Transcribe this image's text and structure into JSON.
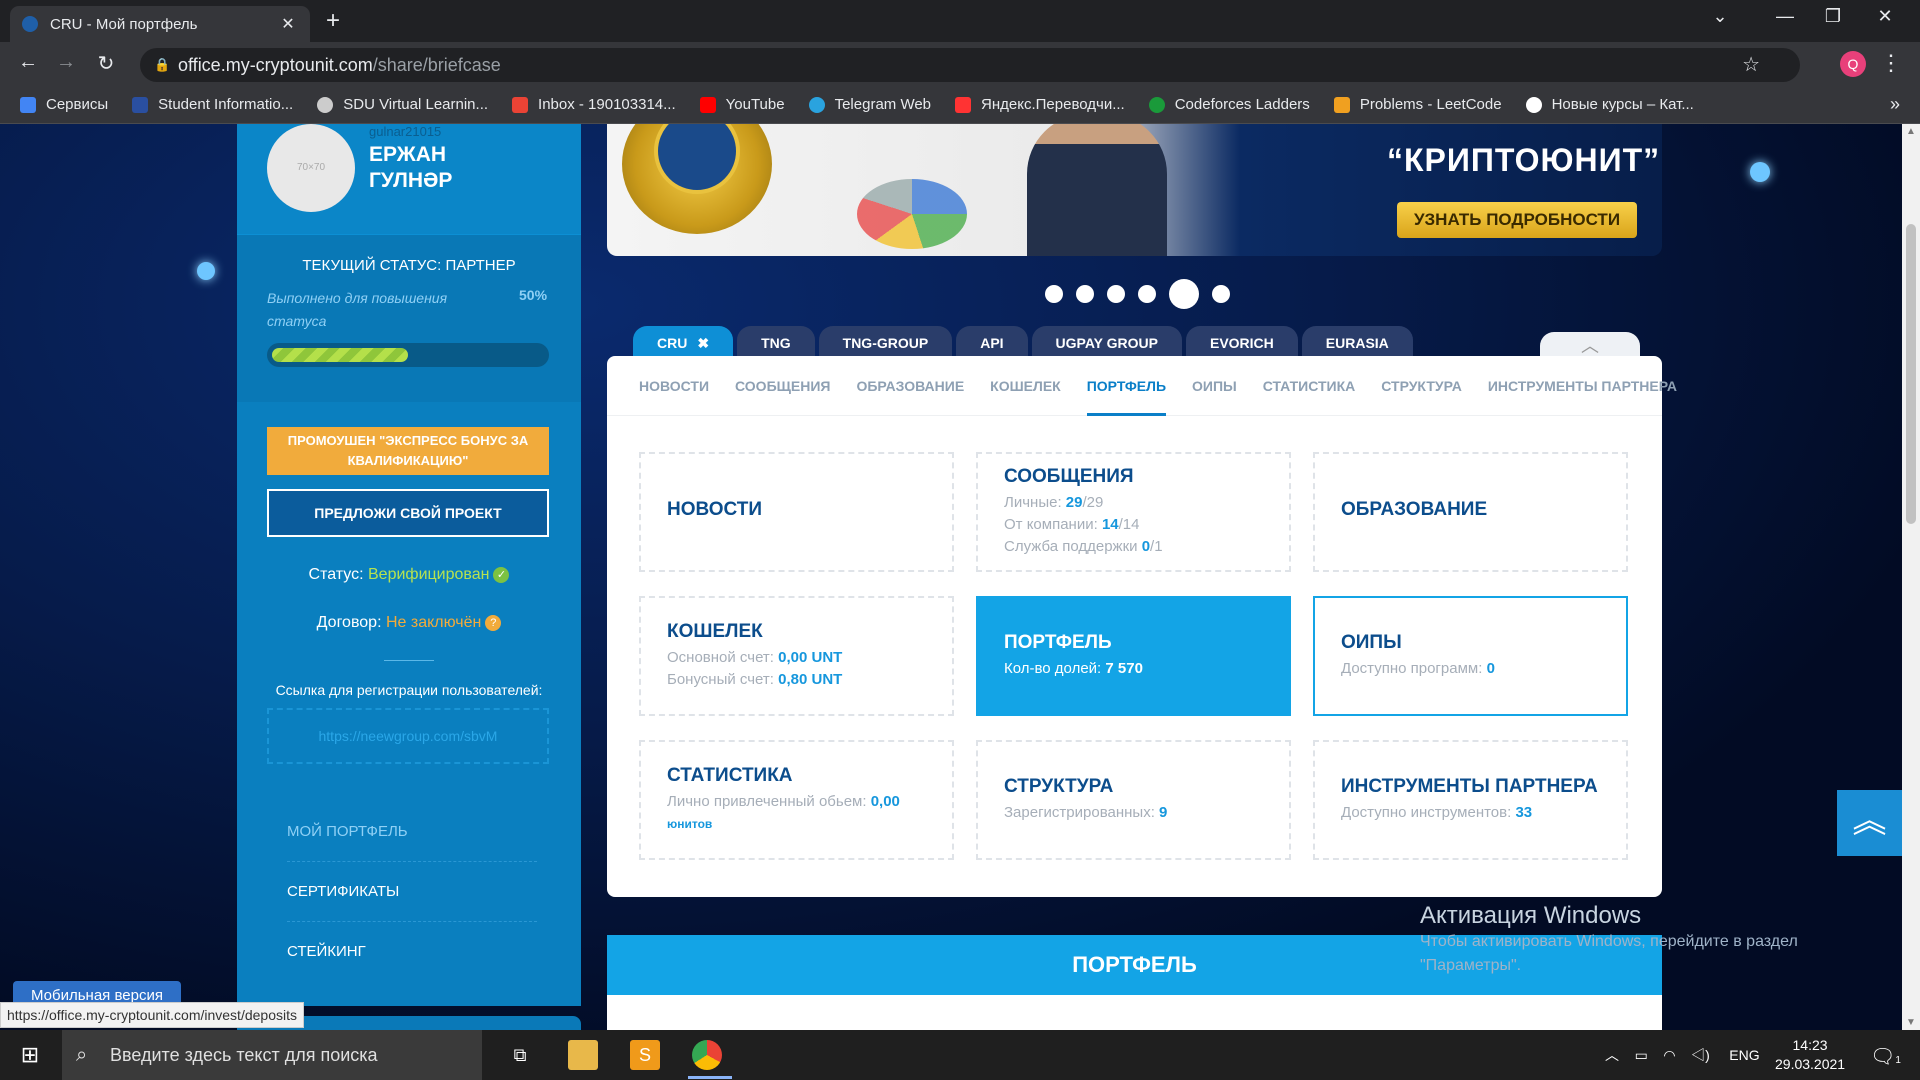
{
  "browser": {
    "tab_title": "CRU - Мой портфель",
    "tab_close": "✕",
    "new_tab": "+",
    "url_host": "office.my-cryptounit.com",
    "url_path": "/share/briefcase",
    "profile_initial": "Q",
    "bookmarks": [
      {
        "label": "Сервисы",
        "color": "#4285f4"
      },
      {
        "label": "Student Informatio...",
        "color": "#2a4fa0"
      },
      {
        "label": "SDU Virtual Learnin...",
        "color": "#cccccc"
      },
      {
        "label": "Inbox - 190103314...",
        "color": "#ea4335"
      },
      {
        "label": "YouTube",
        "color": "#ff0000"
      },
      {
        "label": "Telegram Web",
        "color": "#2aa3df"
      },
      {
        "label": "Яндекс.Переводчи...",
        "color": "#ff3333"
      },
      {
        "label": "Codeforces Ladders",
        "color": "#1a9a3a"
      },
      {
        "label": "Problems - LeetCode",
        "color": "#f0a020"
      },
      {
        "label": "Новые курсы – Кат...",
        "color": "#ffffff"
      }
    ],
    "status_url": "https://office.my-cryptounit.com/invest/deposits"
  },
  "sidebar": {
    "username": "gulnar21015",
    "full_name": "ЕРЖАН ГУЛНӘР",
    "avatar_placeholder": "70×70",
    "status_title": "ТЕКУЩИЙ СТАТУС: ПАРТНЕР",
    "progress_text": "Выполнено для повышения статуса",
    "progress_pct": "50%",
    "progress_value": 0.5,
    "promo_button": "ПРОМОУШЕН \"ЭКСПРЕСС БОНУС ЗА КВАЛИФИКАЦИЮ\"",
    "project_button": "ПРЕДЛОЖИ СВОЙ ПРОЕКТ",
    "status_label": "Статус:",
    "status_value": "Верифицирован",
    "contract_label": "Договор:",
    "contract_value": "Не заключён",
    "ref_label": "Ссылка для регистрации пользователей:",
    "ref_link": "https://neewgroup.com/sbvM",
    "menu": [
      "МОЙ ПОРТФЕЛЬ",
      "СЕРТИФИКАТЫ",
      "СТЕЙКИНГ"
    ],
    "mobile_version": "Мобильная версия"
  },
  "banner": {
    "title": "“КРИПТОЮНИТ”",
    "button": "УЗНАТЬ ПОДРОБНОСТИ"
  },
  "project_tabs": [
    "CRU",
    "TNG",
    "TNG-GROUP",
    "API",
    "UGPAY GROUP",
    "EVORICH",
    "EURASIA"
  ],
  "subnav": [
    "НОВОСТИ",
    "СООБЩЕНИЯ",
    "ОБРАЗОВАНИЕ",
    "КОШЕЛЕК",
    "ПОРТФЕЛЬ",
    "ОИПЫ",
    "СТАТИСТИКА",
    "СТРУКТУРА",
    "ИНСТРУМЕНТЫ ПАРТНЕРА"
  ],
  "tiles": {
    "news": {
      "title": "НОВОСТИ"
    },
    "messages": {
      "title": "СООБЩЕНИЯ",
      "personal_label": "Личные:",
      "personal_value": "29",
      "personal_total": "/29",
      "company_label": "От компании:",
      "company_value": "14",
      "company_total": "/14",
      "support_label": "Служба поддержки",
      "support_value": "0",
      "support_total": "/1"
    },
    "education": {
      "title": "ОБРАЗОВАНИЕ"
    },
    "wallet": {
      "title": "КОШЕЛЕК",
      "main_label": "Основной счет:",
      "main_value": "0,00 UNT",
      "bonus_label": "Бонусный счет:",
      "bonus_value": "0,80 UNT"
    },
    "portfolio": {
      "title": "ПОРТФЕЛЬ",
      "shares_label": "Кол-во долей:",
      "shares_value": "7 570"
    },
    "oips": {
      "title": "ОИПЫ",
      "label": "Доступно программ:",
      "value": "0"
    },
    "stats": {
      "title": "СТАТИСТИКА",
      "label": "Лично привлеченный обьем:",
      "value": "0,00",
      "unit": "юнитов"
    },
    "structure": {
      "title": "СТРУКТУРА",
      "label": "Зарегистрированных:",
      "value": "9"
    },
    "tools": {
      "title": "ИНСТРУМЕНТЫ ПАРТНЕРА",
      "label": "Доступно инструментов:",
      "value": "33"
    }
  },
  "portfolio_header": "ПОРТФЕЛЬ",
  "activation": {
    "title": "Активация Windows",
    "text": "Чтобы активировать Windows, перейдите в раздел \"Параметры\"."
  },
  "taskbar": {
    "search_placeholder": "Введите здесь текст для поиска",
    "lang": "ENG",
    "time": "14:23",
    "date": "29.03.2021",
    "notif_count": "1"
  }
}
